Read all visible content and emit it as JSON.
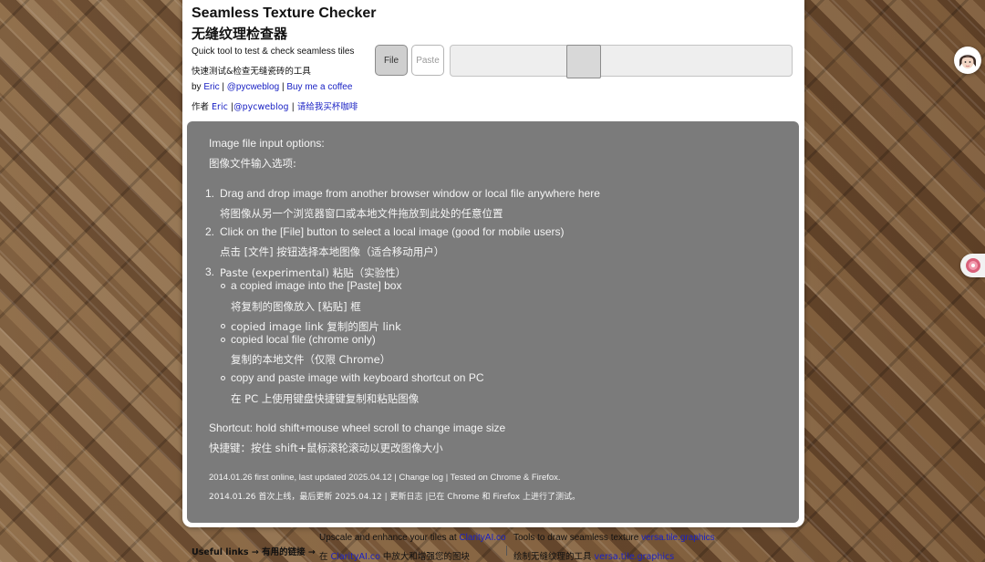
{
  "header": {
    "title_en": "Seamless Texture Checker",
    "title_zh": "无缝纹理检查器",
    "subtitle_en": "Quick tool to test & check seamless tiles",
    "subtitle_zh": "快速测试&检查无缝瓷砖的工具",
    "by_en": {
      "prefix": "by",
      "author": "Eric",
      "sep1": "|",
      "handle": "@pycweblog",
      "sep2": "|",
      "coffee": "Buy me a coffee"
    },
    "by_zh": {
      "prefix": "作者",
      "author": "Eric",
      "sep1": "|",
      "handle": "@pycweblog",
      "sep2": "|",
      "coffee": "请给我买杯咖啡"
    }
  },
  "toolbar": {
    "file_label": "File",
    "paste_label": "Paste",
    "size_slider": {
      "value": 0.34
    }
  },
  "info": {
    "heading_en": "Image file input options:",
    "heading_zh": "图像文件输入选项:",
    "items": [
      {
        "num": "1.",
        "en": "Drag and drop image from another browser window or local file anywhere here",
        "zh": "将图像从另一个浏览器窗口或本地文件拖放到此处的任意位置"
      },
      {
        "num": "2.",
        "en": "Click on the [File] button to select a local image (good for mobile users)",
        "zh": "点击 [文件] 按钮选择本地图像（适合移动用户）"
      },
      {
        "num": "3.",
        "en": "Paste (experimental)  粘贴（实验性）"
      }
    ],
    "sub_items": [
      {
        "en": "a copied image into the [Paste] box",
        "zh": "将复制的图像放入 [粘贴] 框"
      },
      {
        "en": "copied image link  复制的图片 link"
      },
      {
        "en": "copied local file (chrome only)",
        "zh": "复制的本地文件（仅限 Chrome）"
      },
      {
        "en": "copy and paste image with keyboard shortcut on PC",
        "zh": "在 PC 上使用键盘快捷键复制和粘贴图像"
      }
    ],
    "shortcut_en": "Shortcut: hold shift+mouse wheel scroll to change image size",
    "shortcut_zh": "快捷键：按住 shift+鼠标滚轮滚动以更改图像大小",
    "footnote_en": "2014.01.26 first online, last updated 2025.04.12 | Change log | Tested on Chrome & Firefox.",
    "footnote_zh": "2014.01.26 首次上线，最后更新 2025.04.12 | 更新日志 |已在 Chrome 和 Firefox 上进行了测试。"
  },
  "footer": {
    "useful_links": "Useful links → 有用的链接 →",
    "upscale_en": "Upscale and enhance your tiles at",
    "upscale_link": "ClarityAI.co",
    "upscale_zh_prefix": "在",
    "upscale_zh_link": "ClarityAI.co",
    "upscale_zh_suffix": "中放大和增强您的图块",
    "tools_en": "Tools to draw seamless texture",
    "tools_link": "versa.tile.graphics",
    "tools_zh": "绘制无缝纹理的工具",
    "tools_zh_link": "versa.tile.graphics"
  },
  "colors": {
    "link": "#1a22c4",
    "info_panel": "#7b7b7b",
    "panel_bg": "#ffffff"
  },
  "icons": {
    "avatar": "avatar-icon",
    "side_tab": "side-tab-icon"
  }
}
